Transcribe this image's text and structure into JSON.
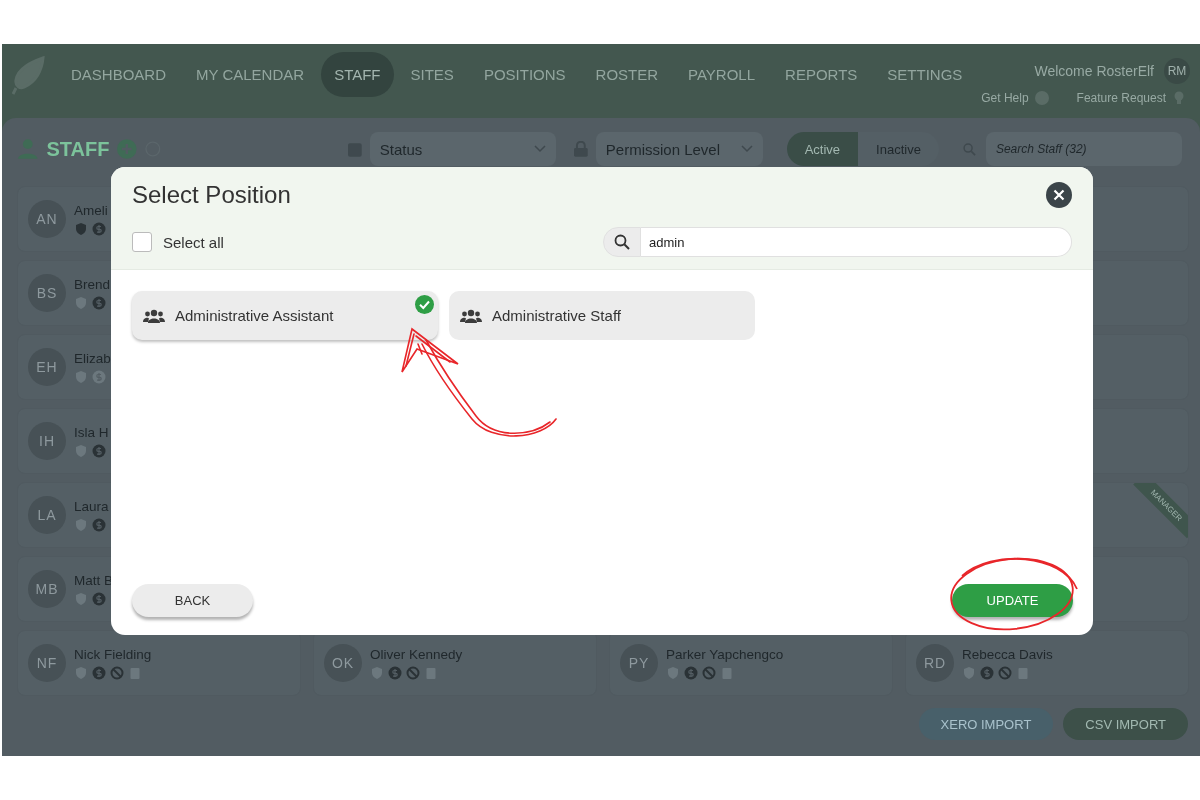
{
  "nav": {
    "items": [
      {
        "label": "DASHBOARD",
        "selected": false
      },
      {
        "label": "MY CALENDAR",
        "selected": false
      },
      {
        "label": "STAFF",
        "selected": true
      },
      {
        "label": "SITES",
        "selected": false
      },
      {
        "label": "POSITIONS",
        "selected": false
      },
      {
        "label": "ROSTER",
        "selected": false
      },
      {
        "label": "PAYROLL",
        "selected": false
      },
      {
        "label": "REPORTS",
        "selected": false
      },
      {
        "label": "SETTINGS",
        "selected": false
      }
    ],
    "welcome": "Welcome RosterElf",
    "avatar_initials": "RM",
    "help_link": "Get Help",
    "feature_link": "Feature Request"
  },
  "toolbar": {
    "title": "STAFF",
    "status_filter": "Status",
    "permission_filter": "Permission Level",
    "toggle": [
      {
        "label": "Active",
        "selected": true
      },
      {
        "label": "Inactive",
        "selected": false
      }
    ],
    "search": {
      "placeholder": "Search Staff (32)"
    }
  },
  "left_cards": [
    {
      "initials": "AN",
      "name": "Ameli",
      "icons": [
        {
          "kind": "shield",
          "on": true
        },
        {
          "kind": "dollar",
          "on": true
        }
      ]
    },
    {
      "initials": "BS",
      "name": "Brend",
      "icons": [
        {
          "kind": "shield",
          "on": false
        },
        {
          "kind": "dollar",
          "on": true
        }
      ]
    },
    {
      "initials": "EH",
      "name": "Elizab",
      "icons": [
        {
          "kind": "shield",
          "on": false
        },
        {
          "kind": "dollar",
          "on": false
        }
      ]
    },
    {
      "initials": "IH",
      "name": "Isla H",
      "icons": [
        {
          "kind": "shield",
          "on": false
        },
        {
          "kind": "dollar",
          "on": true
        }
      ]
    },
    {
      "initials": "LA",
      "name": "Laura",
      "icons": [
        {
          "kind": "shield",
          "on": false
        },
        {
          "kind": "dollar",
          "on": true
        }
      ]
    },
    {
      "initials": "MB",
      "name": "Matt B",
      "icons": [
        {
          "kind": "shield",
          "on": false
        },
        {
          "kind": "dollar",
          "on": true
        }
      ]
    }
  ],
  "right_cards": [
    {
      "manager": false
    },
    {
      "manager": false
    },
    {
      "manager": false
    },
    {
      "manager": false
    },
    {
      "manager": true
    },
    {
      "manager": false
    }
  ],
  "manager_badge": "MANAGER",
  "bottom_cards": [
    {
      "initials": "NF",
      "name": "Nick Fielding",
      "icons": [
        {
          "kind": "shield",
          "on": false
        },
        {
          "kind": "dollar",
          "on": true
        },
        {
          "kind": "ban",
          "on": true
        },
        {
          "kind": "clipboard",
          "on": false
        }
      ]
    },
    {
      "initials": "OK",
      "name": "Oliver Kennedy",
      "icons": [
        {
          "kind": "shield",
          "on": false
        },
        {
          "kind": "dollar",
          "on": true
        },
        {
          "kind": "ban",
          "on": true
        },
        {
          "kind": "clipboard",
          "on": false
        }
      ]
    },
    {
      "initials": "PY",
      "name": "Parker Yapchengco",
      "icons": [
        {
          "kind": "shield",
          "on": false
        },
        {
          "kind": "dollar",
          "on": true
        },
        {
          "kind": "ban",
          "on": true
        },
        {
          "kind": "clipboard",
          "on": false
        }
      ]
    },
    {
      "initials": "RD",
      "name": "Rebecca Davis",
      "icons": [
        {
          "kind": "shield",
          "on": false
        },
        {
          "kind": "dollar",
          "on": true
        },
        {
          "kind": "ban",
          "on": true
        },
        {
          "kind": "clipboard",
          "on": false
        }
      ]
    }
  ],
  "import_buttons": [
    {
      "label": "XERO IMPORT",
      "kind": "xero"
    },
    {
      "label": "CSV IMPORT",
      "kind": "csv"
    }
  ],
  "modal": {
    "title": "Select Position",
    "select_all": {
      "label": "Select all",
      "checked": false
    },
    "search": {
      "value": "admin"
    },
    "positions": [
      {
        "label": "Administrative Assistant",
        "selected": true
      },
      {
        "label": "Administrative Staff",
        "selected": false
      }
    ],
    "back": "BACK",
    "update": "UPDATE"
  }
}
